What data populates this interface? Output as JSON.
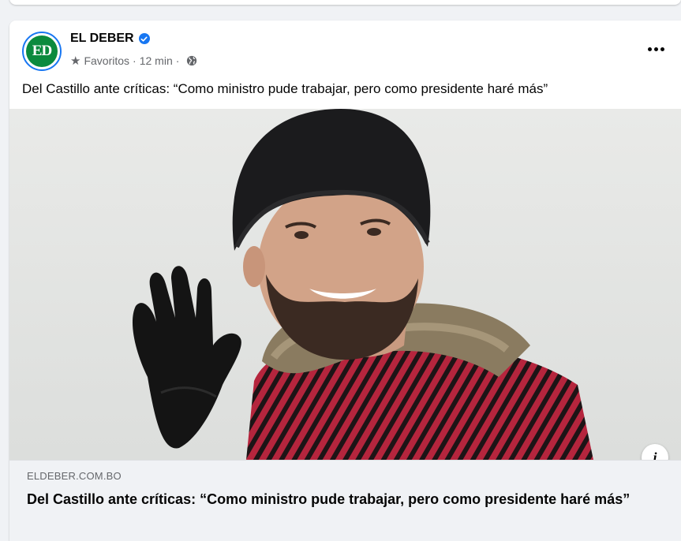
{
  "post": {
    "page_name": "EL DEBER",
    "avatar_text": "ED",
    "audience": "Favoritos",
    "separator": "·",
    "time": "12 min",
    "text": "Del Castillo ante críticas: “Como ministro pude trabajar, pero como presidente haré más”",
    "icons": {
      "verified": "verified-badge-icon",
      "favorite": "star-icon",
      "privacy": "globe-icon",
      "more": "more-options-icon",
      "info": "info-icon"
    },
    "colors": {
      "brand_blue": "#1877f2",
      "avatar_green": "#0b8a3e",
      "secondary_text": "#65676b"
    }
  },
  "link_preview": {
    "domain": "ELDEBER.COM.BO",
    "title": "Del Castillo ante críticas: “Como ministro pude trabajar, pero como presidente haré más”"
  },
  "info_label": "i"
}
